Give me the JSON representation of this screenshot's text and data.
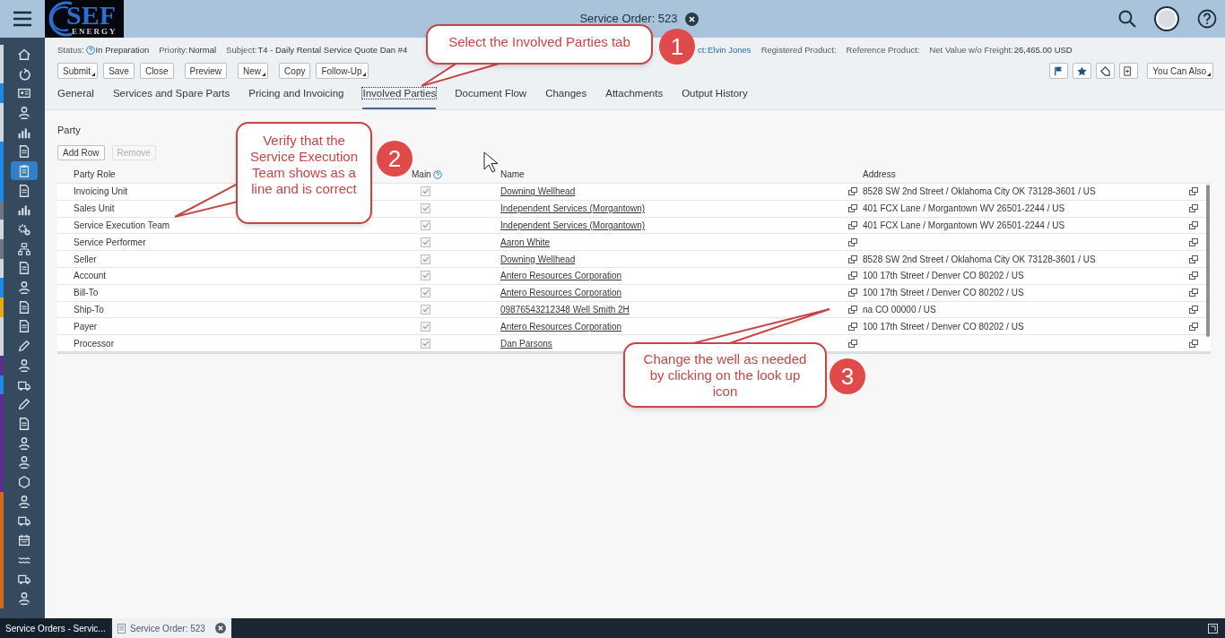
{
  "window": {
    "title": "Service Order: 523"
  },
  "logo": {
    "text": "SEF",
    "subtext": "ENERGY"
  },
  "sidebar": {
    "items": [
      {
        "kind": "home",
        "color": "#d0d6dc",
        "selected": false
      },
      {
        "kind": "refresh",
        "color": "#d0d6dc",
        "selected": false
      },
      {
        "kind": "card",
        "color": "#1e88e5",
        "selected": false
      },
      {
        "kind": "person",
        "color": "#d0d6dc",
        "selected": false
      },
      {
        "kind": "chart",
        "color": "#d0d6dc",
        "selected": false
      },
      {
        "kind": "document",
        "color": "#1e88e5",
        "selected": false
      },
      {
        "kind": "clipboard",
        "color": "#1e88e5",
        "selected": true
      },
      {
        "kind": "document",
        "color": "#1e88e5",
        "selected": false
      },
      {
        "kind": "chart",
        "color": "#6b7785",
        "selected": false
      },
      {
        "kind": "gear",
        "color": "#d0d6dc",
        "selected": false
      },
      {
        "kind": "hierarchy",
        "color": "#6b7785",
        "selected": false
      },
      {
        "kind": "document",
        "color": "#d0d6dc",
        "selected": false
      },
      {
        "kind": "person",
        "color": "#1e88e5",
        "selected": false
      },
      {
        "kind": "document",
        "color": "#e6a817",
        "selected": false
      },
      {
        "kind": "document",
        "color": "#d0d6dc",
        "selected": false
      },
      {
        "kind": "pencil",
        "color": "#d0d6dc",
        "selected": false
      },
      {
        "kind": "person",
        "color": "#5b2d8c",
        "selected": false
      },
      {
        "kind": "truck",
        "color": "#1e88e5",
        "selected": false
      },
      {
        "kind": "pencil",
        "color": "#5b2d8c",
        "selected": false
      },
      {
        "kind": "document",
        "color": "#5b2d8c",
        "selected": false
      },
      {
        "kind": "person",
        "color": "#5b2d8c",
        "selected": false
      },
      {
        "kind": "person",
        "color": "#5b2d8c",
        "selected": false
      },
      {
        "kind": "hexagon",
        "color": "#5b2d8c",
        "selected": false
      },
      {
        "kind": "person",
        "color": "#d2691e",
        "selected": false
      },
      {
        "kind": "truck",
        "color": "#d2691e",
        "selected": false
      },
      {
        "kind": "calendar",
        "color": "#d2691e",
        "selected": false
      },
      {
        "kind": "wave",
        "color": "#d2691e",
        "selected": false
      },
      {
        "kind": "truck",
        "color": "#d2691e",
        "selected": false
      },
      {
        "kind": "person",
        "color": "#d2691e",
        "selected": false
      }
    ]
  },
  "header": {
    "fields": [
      {
        "label": "Status:",
        "value": "In Preparation",
        "help": true,
        "link": false
      },
      {
        "label": "Priority:",
        "value": "Normal",
        "help": false,
        "link": false
      },
      {
        "label": "Subject:",
        "value": "T4 - Daily Rental Service Quote Dan #4",
        "help": false,
        "link": false
      },
      {
        "label": "ct:",
        "value": "Elvin Jones",
        "help": false,
        "link": true
      },
      {
        "label": "Registered Product:",
        "help": false,
        "link": false
      },
      {
        "label": "Reference Product:",
        "help": false,
        "link": false
      },
      {
        "label": "Net Value w/o Freight:",
        "value": "26,465.00 USD",
        "help": false,
        "link": false
      }
    ],
    "button_groups": [
      [
        {
          "label": "Submit",
          "menu": true
        },
        {
          "label": "Save",
          "menu": false
        },
        {
          "label": "Close",
          "menu": false
        }
      ],
      [
        {
          "label": "Preview",
          "menu": false
        }
      ],
      [
        {
          "label": "New",
          "menu": true
        }
      ],
      [
        {
          "label": "Copy",
          "menu": false
        },
        {
          "label": "Follow-Up",
          "menu": true
        }
      ]
    ],
    "more_button": {
      "label": "You Can Also",
      "menu": true
    }
  },
  "tabs": [
    {
      "label": "General",
      "selected": false
    },
    {
      "label": "Services and Spare Parts",
      "selected": false
    },
    {
      "label": "Pricing and Invoicing",
      "selected": false
    },
    {
      "label": "Involved Parties",
      "selected": true
    },
    {
      "label": "Document Flow",
      "selected": false
    },
    {
      "label": "Changes",
      "selected": false
    },
    {
      "label": "Attachments",
      "selected": false
    },
    {
      "label": "Output History",
      "selected": false
    }
  ],
  "section": {
    "title": "Party",
    "buttons": [
      {
        "label": "Add Row",
        "disabled": false
      },
      {
        "label": "Remove",
        "disabled": true
      }
    ]
  },
  "table": {
    "columns": [
      {
        "label": "Party Role",
        "help": false
      },
      {
        "label": "Main",
        "help": true
      },
      {
        "label": "Name",
        "help": false
      },
      {
        "label": "Address",
        "help": false
      }
    ],
    "rows": [
      {
        "role": "Invoicing Unit",
        "main": true,
        "name": "Downing Wellhead",
        "address": "8528 SW 2nd Street / Oklahoma City OK 73128-3601 / US"
      },
      {
        "role": "Sales Unit",
        "main": true,
        "name": "Independent Services (Morgantown)",
        "address": "401 FCX Lane / Morgantown WV 26501-2244 / US"
      },
      {
        "role": "Service Execution Team",
        "main": true,
        "name": "Independent Services (Morgantown)",
        "address": "401 FCX Lane / Morgantown WV 26501-2244 / US"
      },
      {
        "role": "Service Performer",
        "main": true,
        "name": "Aaron White"
      },
      {
        "role": "Seller",
        "main": true,
        "name": "Downing Wellhead",
        "address": "8528 SW 2nd Street / Oklahoma City OK 73128-3601 / US"
      },
      {
        "role": "Account",
        "main": true,
        "name": "Antero Resources Corporation",
        "address": "100 17th Street / Denver CO 80202 / US"
      },
      {
        "role": "Bill-To",
        "main": true,
        "name": "Antero Resources Corporation",
        "address": "100 17th Street / Denver CO 80202 / US"
      },
      {
        "role": "Ship-To",
        "main": true,
        "name": "09876543212348 Well Smith 2H",
        "address": "na CO 00000 / US"
      },
      {
        "role": "Payer",
        "main": true,
        "name": "Antero Resources Corporation",
        "address": "100 17th Street / Denver CO 80202 / US"
      },
      {
        "role": "Processor",
        "main": true,
        "name": "Dan Parsons"
      }
    ]
  },
  "callouts": [
    {
      "number": "1",
      "text": "Select the Involved Parties tab"
    },
    {
      "number": "2",
      "text": "Verify that the Service Execution Team shows as a line and is correct"
    },
    {
      "number": "3",
      "text": "Change the well as needed by clicking on the look up icon"
    }
  ],
  "taskbar": {
    "items": [
      {
        "label": "Service Orders - Servic...",
        "selected": false
      },
      {
        "label": "Service Order: 523",
        "selected": true
      }
    ]
  }
}
